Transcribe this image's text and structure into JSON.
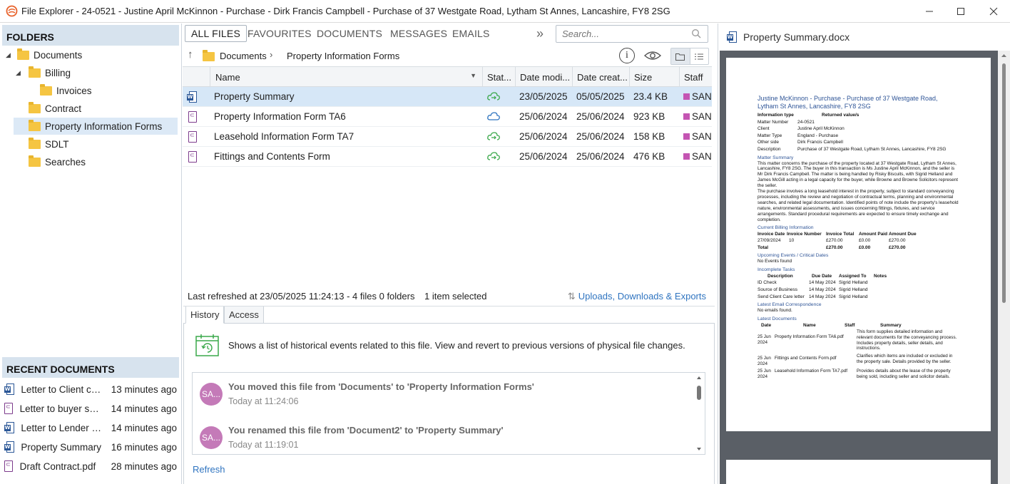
{
  "window": {
    "title": "File Explorer - 24-0521 - Justine April McKinnon - Purchase - Dirk Francis Campbell - Purchase of 37 Westgate Road, Lytham St Annes, Lancashire, FY8 2SG"
  },
  "folders": {
    "header": "FOLDERS",
    "items": [
      {
        "label": "Documents",
        "level": 0,
        "expanded": true
      },
      {
        "label": "Billing",
        "level": 1,
        "expanded": true
      },
      {
        "label": "Invoices",
        "level": 2
      },
      {
        "label": "Contract",
        "level": 1
      },
      {
        "label": "Property Information Forms",
        "level": 1,
        "selected": true
      },
      {
        "label": "SDLT",
        "level": 1
      },
      {
        "label": "Searches",
        "level": 1
      }
    ]
  },
  "recent": {
    "header": "RECENT DOCUMENTS",
    "items": [
      {
        "name": "Letter to Client con...",
        "time": "13 minutes ago",
        "type": "word"
      },
      {
        "name": "Letter to buyer soli...",
        "time": "14 minutes ago",
        "type": "pdf"
      },
      {
        "name": "Letter to Lender en...",
        "time": "14 minutes ago",
        "type": "word"
      },
      {
        "name": "Property Summary",
        "time": "16 minutes ago",
        "type": "word"
      },
      {
        "name": "Draft Contract.pdf",
        "time": "28 minutes ago",
        "type": "pdf"
      }
    ]
  },
  "tabs": [
    "ALL FILES",
    "FAVOURITES",
    "DOCUMENTS",
    "MESSAGES",
    "EMAILS"
  ],
  "search": {
    "placeholder": "Search..."
  },
  "breadcrumb": {
    "root": "Documents",
    "current": "Property Information Forms"
  },
  "table": {
    "columns": [
      "Name",
      "Stat...",
      "Date modi...",
      "Date creat...",
      "Size",
      "Staff"
    ],
    "rows": [
      {
        "name": "Property Summary",
        "type": "word",
        "status": "synced",
        "modified": "23/05/2025",
        "created": "05/05/2025",
        "size": "23.4 KB",
        "staff": "SAN",
        "selected": true
      },
      {
        "name": "Property Information Form TA6",
        "type": "pdf",
        "status": "cloud",
        "modified": "25/06/2024",
        "created": "25/06/2024",
        "size": "923 KB",
        "staff": "SAN"
      },
      {
        "name": "Leasehold Information Form TA7",
        "type": "pdf",
        "status": "synced",
        "modified": "25/06/2024",
        "created": "25/06/2024",
        "size": "158 KB",
        "staff": "SAN"
      },
      {
        "name": "Fittings and Contents Form",
        "type": "pdf",
        "status": "synced",
        "modified": "25/06/2024",
        "created": "25/06/2024",
        "size": "476 KB",
        "staff": "SAN"
      }
    ]
  },
  "status": {
    "refreshed": "Last refreshed at 23/05/2025 11:24:13  -  4 files  0 folders",
    "selected": "1 item selected",
    "uploads": "Uploads, Downloads & Exports"
  },
  "history": {
    "tabs": [
      "History",
      "Access"
    ],
    "description": "Shows a list of historical events related to this file. View and revert to previous versions of physical file changes.",
    "events": [
      {
        "initials": "SA...",
        "text": "You moved this file from 'Documents' to 'Property Information Forms'",
        "time": "Today at 11:24:06"
      },
      {
        "initials": "SA...",
        "text": "You renamed this file from 'Document2' to 'Property Summary'",
        "time": "Today at 11:19:01"
      }
    ],
    "refresh": "Refresh"
  },
  "preview": {
    "title": "Property Summary.docx",
    "doc": {
      "heading": "Justine McKinnon - Purchase - Purchase of 37 Westgate Road, Lytham St Annes, Lancashire, FY8 2SG",
      "info_headers": [
        "Information type",
        "Returned value/s"
      ],
      "info": [
        [
          "Matter Number",
          "24-0521"
        ],
        [
          "Client",
          "Justine April McKinnon"
        ],
        [
          "Matter Type",
          "England - Purchase"
        ],
        [
          "Other side",
          "Dirk Francis Campbell"
        ],
        [
          "Description",
          "Purchase of 37 Westgate Road, Lytham St Annes, Lancashire, FY8 2SG"
        ]
      ],
      "summary_title": "Matter Summary",
      "summary_p1": "This matter concerns the purchase of the property located at 37 Westgate Road, Lytham St Annes, Lancashire, FY8 2SG. The buyer in this transaction is Ms Justine April McKinnon, and the seller is Mr Dirk Francis Campbell. The matter is being handled by Risky Biscuits, with Sigrid Helland and James McGill acting in a legal capacity for the buyer, while Browne and Browne Solicitors represent the seller.",
      "summary_p2": "The purchase involves a long leasehold interest in the property, subject to standard conveyancing processes, including the review and negotiation of contractual terms, planning and environmental searches, and related legal documentation. Identified points of note include the property's leasehold nature, environmental assessments, and issues concerning fittings, fixtures, and service arrangements. Standard procedural requirements are expected to ensure timely exchange and completion.",
      "billing_title": "Current Billing Information",
      "billing_headers": [
        "Invoice Date",
        "Invoice Number",
        "Invoice Total",
        "Amount Paid",
        "Amount Due"
      ],
      "billing_rows": [
        [
          "27/09/2024",
          "10",
          "£270.00",
          "£0.00",
          "£270.00"
        ],
        [
          "Total",
          "",
          "£270.00",
          "£0.00",
          "£270.00"
        ]
      ],
      "events_title": "Upcoming Events / Critical Dates",
      "events_text": "No Events found",
      "tasks_title": "Incomplete Tasks",
      "tasks_headers": [
        "Description",
        "Due Date",
        "Assigned To",
        "Notes"
      ],
      "tasks_rows": [
        [
          "ID Check",
          "14 May 2024",
          "Sigrid Helland",
          ""
        ],
        [
          "Source of Business",
          "14 May 2024",
          "Sigrid Helland",
          ""
        ],
        [
          "Send Client Care letter",
          "14 May 2024",
          "Sigrid Helland",
          ""
        ]
      ],
      "email_title": "Latest Email Correspondence",
      "email_text": "No emails found.",
      "docs_title": "Latest Documents",
      "docs_headers": [
        "Date",
        "Name",
        "Staff",
        "Summary"
      ],
      "docs_rows": [
        [
          "25 Jun 2024",
          "Property Information Form TA6.pdf",
          "",
          "This form supplies detailed information and relevant documents for the conveyancing process. Includes property details, seller details, and instructions."
        ],
        [
          "25 Jun 2024",
          "Fittings and Contents Form.pdf",
          "",
          "Clarifies which items are included or excluded in the property sale. Details provided by the seller."
        ],
        [
          "25 Jun 2024",
          "Leasehold Information Form TA7.pdf",
          "",
          "Provides details about the lease of the property being sold, including seller and solicitor details."
        ]
      ]
    }
  },
  "colors": {
    "accent": "#2f74c0",
    "selection": "#d6e7f7",
    "header_bg": "#d7e3ee",
    "avatar": "#c47ab8",
    "staff": "#c455b3"
  }
}
